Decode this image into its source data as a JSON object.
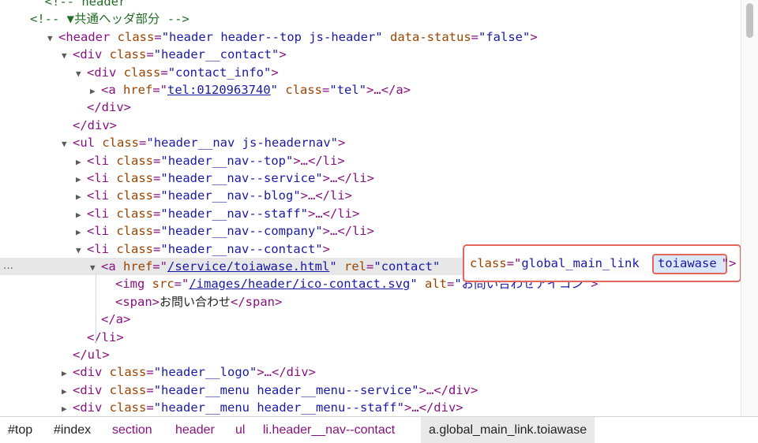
{
  "lines": [
    {
      "indent": 38,
      "tri": "",
      "cls": "cm",
      "text": "  <!-- header"
    },
    {
      "indent": 38,
      "tri": "",
      "cls": "cm",
      "text": "<!-- ▼共通ヘッダ部分 -->"
    },
    {
      "indent": 60,
      "tri": "▼",
      "tag": "<header",
      "attrs": [
        {
          "n": "class",
          "v": "\"header header--top js-header\""
        },
        {
          "n": "data-status",
          "v": "\"false\""
        }
      ],
      "close": ">"
    },
    {
      "indent": 78,
      "tri": "▼",
      "tag": "<div",
      "attrs": [
        {
          "n": "class",
          "v": "\"header__contact\""
        }
      ],
      "close": ">"
    },
    {
      "indent": 96,
      "tri": "▼",
      "tag": "<div",
      "attrs": [
        {
          "n": "class",
          "v": "\"contact_info\""
        }
      ],
      "close": ">"
    },
    {
      "indent": 114,
      "tri": "▶",
      "tag": "<a",
      "attrs": [
        {
          "n": "href",
          "v": "tel:0120963740",
          "link": true
        },
        {
          "n": "class",
          "v": "\"tel\""
        }
      ],
      "close": ">…</a>"
    },
    {
      "indent": 110,
      "tri": "",
      "tag": "</div>",
      "attrs": [],
      "close": ""
    },
    {
      "indent": 92,
      "tri": "",
      "tag": "</div>",
      "attrs": [],
      "close": ""
    },
    {
      "indent": 78,
      "tri": "▼",
      "tag": "<ul",
      "attrs": [
        {
          "n": "class",
          "v": "\"header__nav js-headernav\""
        }
      ],
      "close": ">"
    },
    {
      "indent": 96,
      "tri": "▶",
      "tag": "<li",
      "attrs": [
        {
          "n": "class",
          "v": "\"header__nav--top\""
        }
      ],
      "close": ">…</li>"
    },
    {
      "indent": 96,
      "tri": "▶",
      "tag": "<li",
      "attrs": [
        {
          "n": "class",
          "v": "\"header__nav--service\""
        }
      ],
      "close": ">…</li>"
    },
    {
      "indent": 96,
      "tri": "▶",
      "tag": "<li",
      "attrs": [
        {
          "n": "class",
          "v": "\"header__nav--blog\""
        }
      ],
      "close": ">…</li>"
    },
    {
      "indent": 96,
      "tri": "▶",
      "tag": "<li",
      "attrs": [
        {
          "n": "class",
          "v": "\"header__nav--staff\""
        }
      ],
      "close": ">…</li>"
    },
    {
      "indent": 96,
      "tri": "▶",
      "tag": "<li",
      "attrs": [
        {
          "n": "class",
          "v": "\"header__nav--company\""
        }
      ],
      "close": ">…</li>"
    },
    {
      "indent": 96,
      "tri": "▼",
      "tag": "<li",
      "attrs": [
        {
          "n": "class",
          "v": "\"header__nav--contact\""
        }
      ],
      "close": ">"
    },
    {
      "indent": 114,
      "tri": "▼",
      "sel": true,
      "tag": "<a",
      "attrs": [
        {
          "n": "href",
          "v": "/service/toiawase.html",
          "link": true
        },
        {
          "n": "rel",
          "v": "\"contact\""
        }
      ],
      "close": ""
    },
    {
      "indent": 146,
      "tri": "",
      "tag": "<img",
      "attrs": [
        {
          "n": "src",
          "v": "/images/header/ico-contact.svg",
          "link": true
        },
        {
          "n": "alt",
          "v": "\"お問い合わせアイコン\""
        }
      ],
      "close": ">"
    },
    {
      "indent": 146,
      "tri": "",
      "tag": "<span>",
      "attrs": [],
      "text": "お問い合わせ",
      "close": "</span>"
    },
    {
      "indent": 128,
      "tri": "",
      "tag": "</a>",
      "attrs": [],
      "close": ""
    },
    {
      "indent": 110,
      "tri": "",
      "tag": "</li>",
      "attrs": [],
      "close": ""
    },
    {
      "indent": 92,
      "tri": "",
      "tag": "</ul>",
      "attrs": [],
      "close": ""
    },
    {
      "indent": 78,
      "tri": "▶",
      "tag": "<div",
      "attrs": [
        {
          "n": "class",
          "v": "\"header__logo\""
        }
      ],
      "close": ">…</div>"
    },
    {
      "indent": 78,
      "tri": "▶",
      "tag": "<div",
      "attrs": [
        {
          "n": "class",
          "v": "\"header__menu header__menu--service\""
        }
      ],
      "close": ">…</div>"
    },
    {
      "indent": 78,
      "tri": "▶",
      "tag": "<div",
      "attrs": [
        {
          "n": "class",
          "v": "\"header__menu header__menu--staff\""
        }
      ],
      "close": ">…</div>"
    }
  ],
  "selected_dots": "…",
  "highlight": {
    "attr_name": "class",
    "attr_eq": "=\"",
    "attr_value": "global_main_link ",
    "word": "toiawase",
    "tail": "\">"
  },
  "breadcrumbs": [
    {
      "label": "#top",
      "color": "#222222"
    },
    {
      "label": "#index",
      "color": "#222222"
    },
    {
      "label": "section",
      "color": "#881280"
    },
    {
      "label": "header",
      "color": "#881280"
    },
    {
      "label": "ul",
      "color": "#881280"
    },
    {
      "label": "li.header__nav--contact",
      "color": "#881280"
    },
    {
      "label": "a.global_main_link.toiawase",
      "color": "#222222",
      "active": true
    }
  ],
  "colors": {
    "tag": "#881280",
    "attr_name": "#994500",
    "attr_value": "#1a1aa6",
    "comment": "#236e25",
    "highlight_border": "#e4675d"
  }
}
